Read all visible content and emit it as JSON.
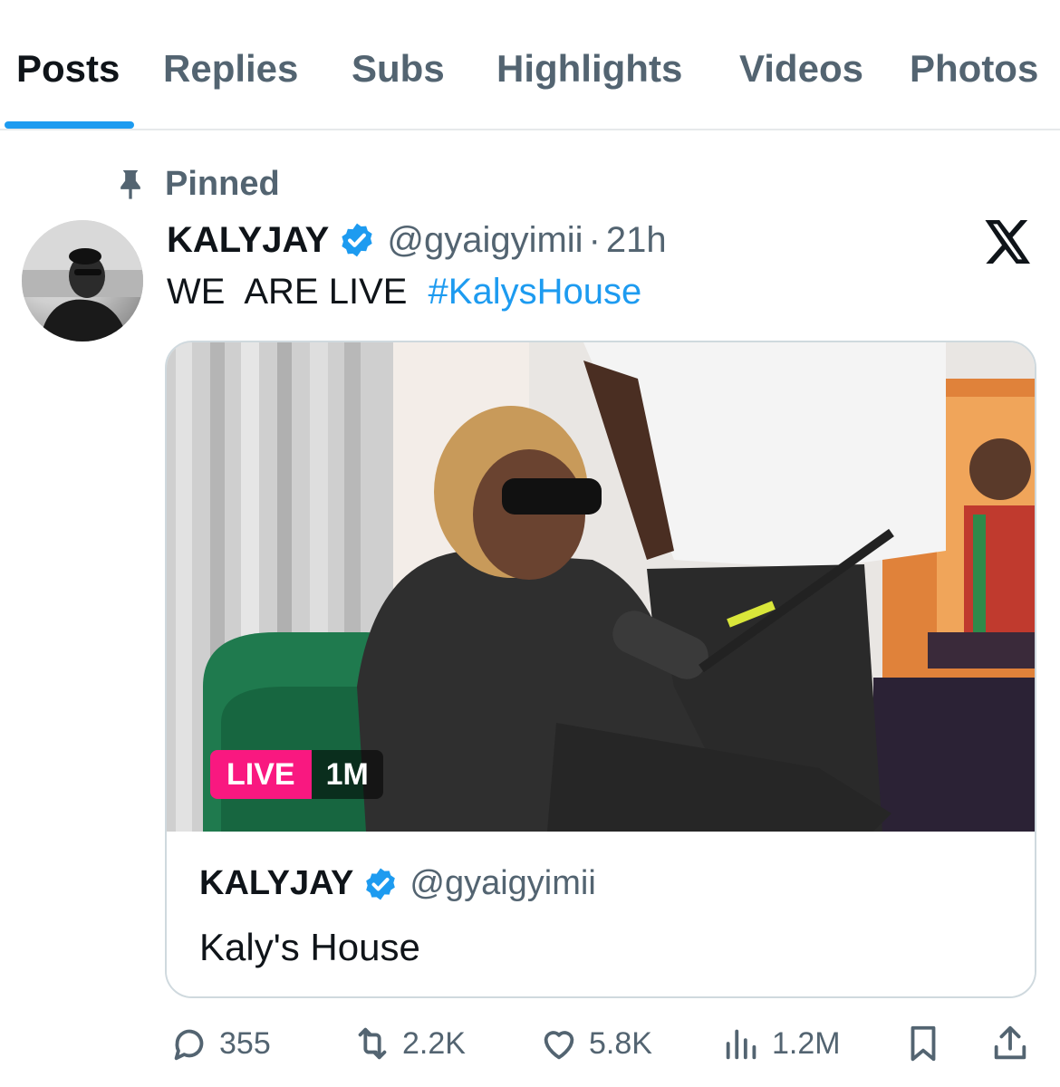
{
  "tabs": [
    {
      "label": "Posts",
      "active": true
    },
    {
      "label": "Replies"
    },
    {
      "label": "Subs"
    },
    {
      "label": "Highlights"
    },
    {
      "label": "Videos"
    },
    {
      "label": "Photos"
    }
  ],
  "pinned_label": "Pinned",
  "post": {
    "display_name": "KALYJAY",
    "handle": "@gyaigyimii",
    "separator": "·",
    "time": "21h",
    "text_words": [
      "WE",
      "ARE LIVE"
    ],
    "hashtag": "#KalysHouse",
    "icons": {
      "verified": "verified-badge-icon",
      "more": "x-logo-icon",
      "pin": "pin-icon"
    }
  },
  "card": {
    "live_label": "LIVE",
    "viewers": "1M",
    "display_name": "KALYJAY",
    "handle": "@gyaigyimii",
    "title": "Kaly's House"
  },
  "actions": {
    "replies": "355",
    "reposts": "2.2K",
    "likes": "5.8K",
    "views": "1.2M"
  },
  "colors": {
    "accent": "#1d9bf0",
    "live": "#f91880",
    "muted_text": "#536471",
    "text": "#0f1419",
    "border": "#cfd9de"
  }
}
